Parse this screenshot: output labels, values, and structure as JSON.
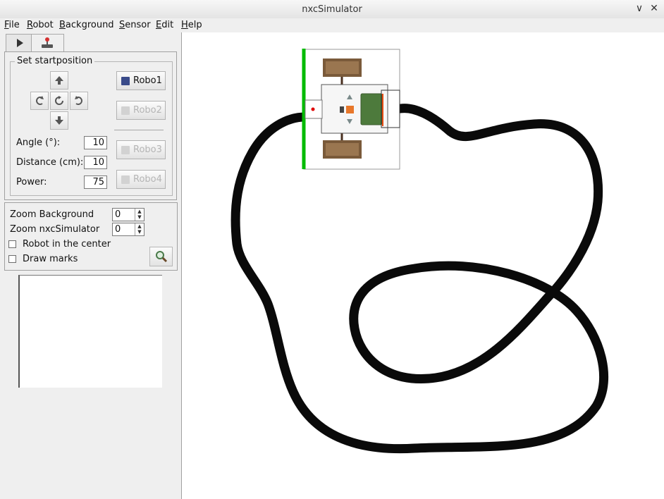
{
  "window": {
    "title": "nxcSimulator",
    "minimize": "∨",
    "close": "✕"
  },
  "menu": [
    "File",
    "Robot",
    "Background",
    "Sensor",
    "Edit",
    "Help"
  ],
  "tabs": {
    "play_icon": "play-icon",
    "joystick_icon": "joystick-icon"
  },
  "startpos": {
    "legend": "Set startposition",
    "angle_label": "Angle (°):",
    "angle_value": "10",
    "distance_label": "Distance (cm):",
    "distance_value": "10",
    "power_label": "Power:",
    "power_value": "75"
  },
  "robots": [
    "Robo1",
    "Robo2",
    "Robo3",
    "Robo4"
  ],
  "zoom": {
    "bg_label": "Zoom Background",
    "bg_value": "0",
    "sim_label": "Zoom nxcSimulator",
    "sim_value": "0",
    "center_label": "Robot in the center",
    "marks_label": "Draw marks"
  },
  "colors": {
    "track": "#0a0a0a",
    "robot_edge": "#00bb00",
    "brick_green": "#4d7a3c"
  }
}
